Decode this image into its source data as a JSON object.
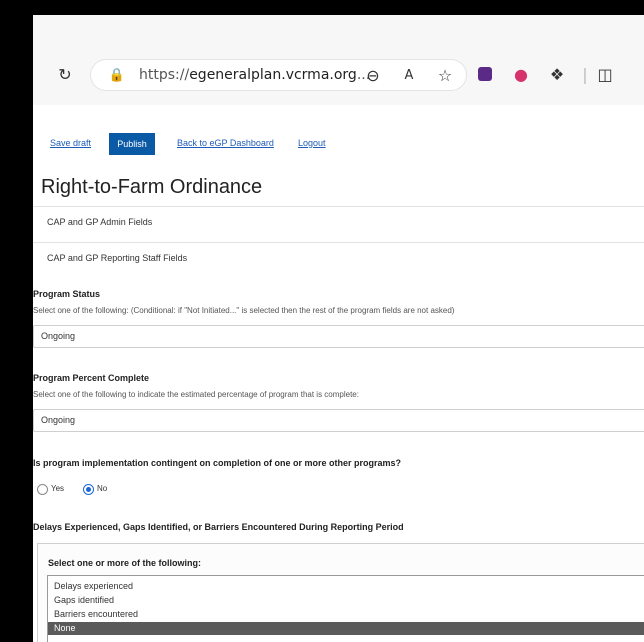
{
  "browser": {
    "url_prefix": "https://",
    "url_host": "egeneralplan.vcrma.org",
    "url_rest": "..."
  },
  "actions": {
    "save_draft": "Save draft",
    "publish": "Publish",
    "back": "Back to eGP Dashboard",
    "logout": "Logout"
  },
  "page_title": "Right-to-Farm Ordinance",
  "sections": [
    "CAP and GP Admin Fields",
    "CAP and GP Reporting Staff Fields"
  ],
  "program_status": {
    "label": "Program Status",
    "help": "Select one of the following: (Conditional: if \"Not Initiated...\" is selected then the rest of the program fields are not asked)",
    "value": "Ongoing"
  },
  "percent_complete": {
    "label": "Program Percent Complete",
    "help": "Select one of the following to indicate the estimated percentage of program that is complete:",
    "value": "Ongoing"
  },
  "contingent": {
    "label": "Is program implementation contingent on completion of one or more other programs?",
    "yes": "Yes",
    "no": "No",
    "selected": "No"
  },
  "delays": {
    "label": "Delays Experienced, Gaps Identified, or Barriers Encountered During Reporting Period",
    "select_label": "Select one or more of the following:",
    "options": [
      "Delays experienced",
      "Gaps identified",
      "Barriers encountered",
      "None"
    ],
    "selected": "None"
  }
}
